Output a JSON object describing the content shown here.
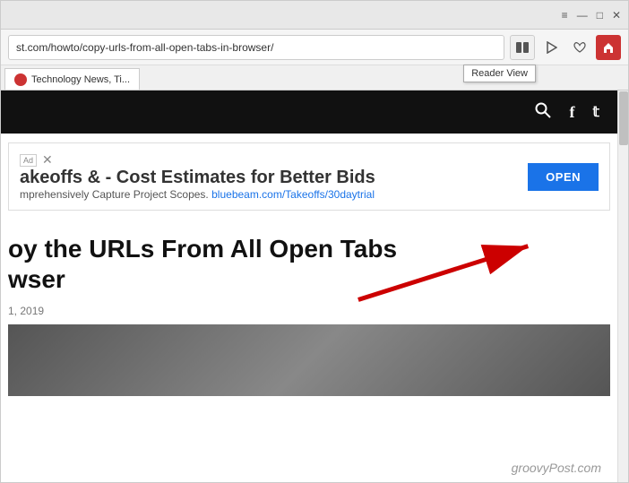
{
  "browser": {
    "title_bar": {
      "minimize_label": "—",
      "restore_label": "□",
      "close_label": "✕",
      "menu_icon": "≡"
    },
    "address_bar": {
      "url": "st.com/howto/copy-urls-from-all-open-tabs-in-browser/"
    },
    "icons": {
      "reader_view_icon": "⬜▷",
      "reading_list_icon": "♡",
      "home_icon": "⌂",
      "tooltip_text": "Reader View"
    },
    "tab": {
      "favicon_color": "#cc3333",
      "label": "Technology News, Ti..."
    }
  },
  "page": {
    "nav": {
      "search_icon": "🔍",
      "facebook_icon": "f",
      "twitter_icon": "t"
    },
    "ad": {
      "title": "akeoffs & - Cost Estimates for Better Bids",
      "description": "mprehensively Capture Project Scopes.",
      "link_text": "bluebeam.com/Takeoffs/30daytrial",
      "open_button": "OPEN",
      "ad_label": "Ad"
    },
    "article": {
      "title_line1": "oy the URLs From All Open Tabs",
      "title_line2": "wser",
      "date": "1, 2019"
    },
    "watermark": "groovyPost.com"
  }
}
